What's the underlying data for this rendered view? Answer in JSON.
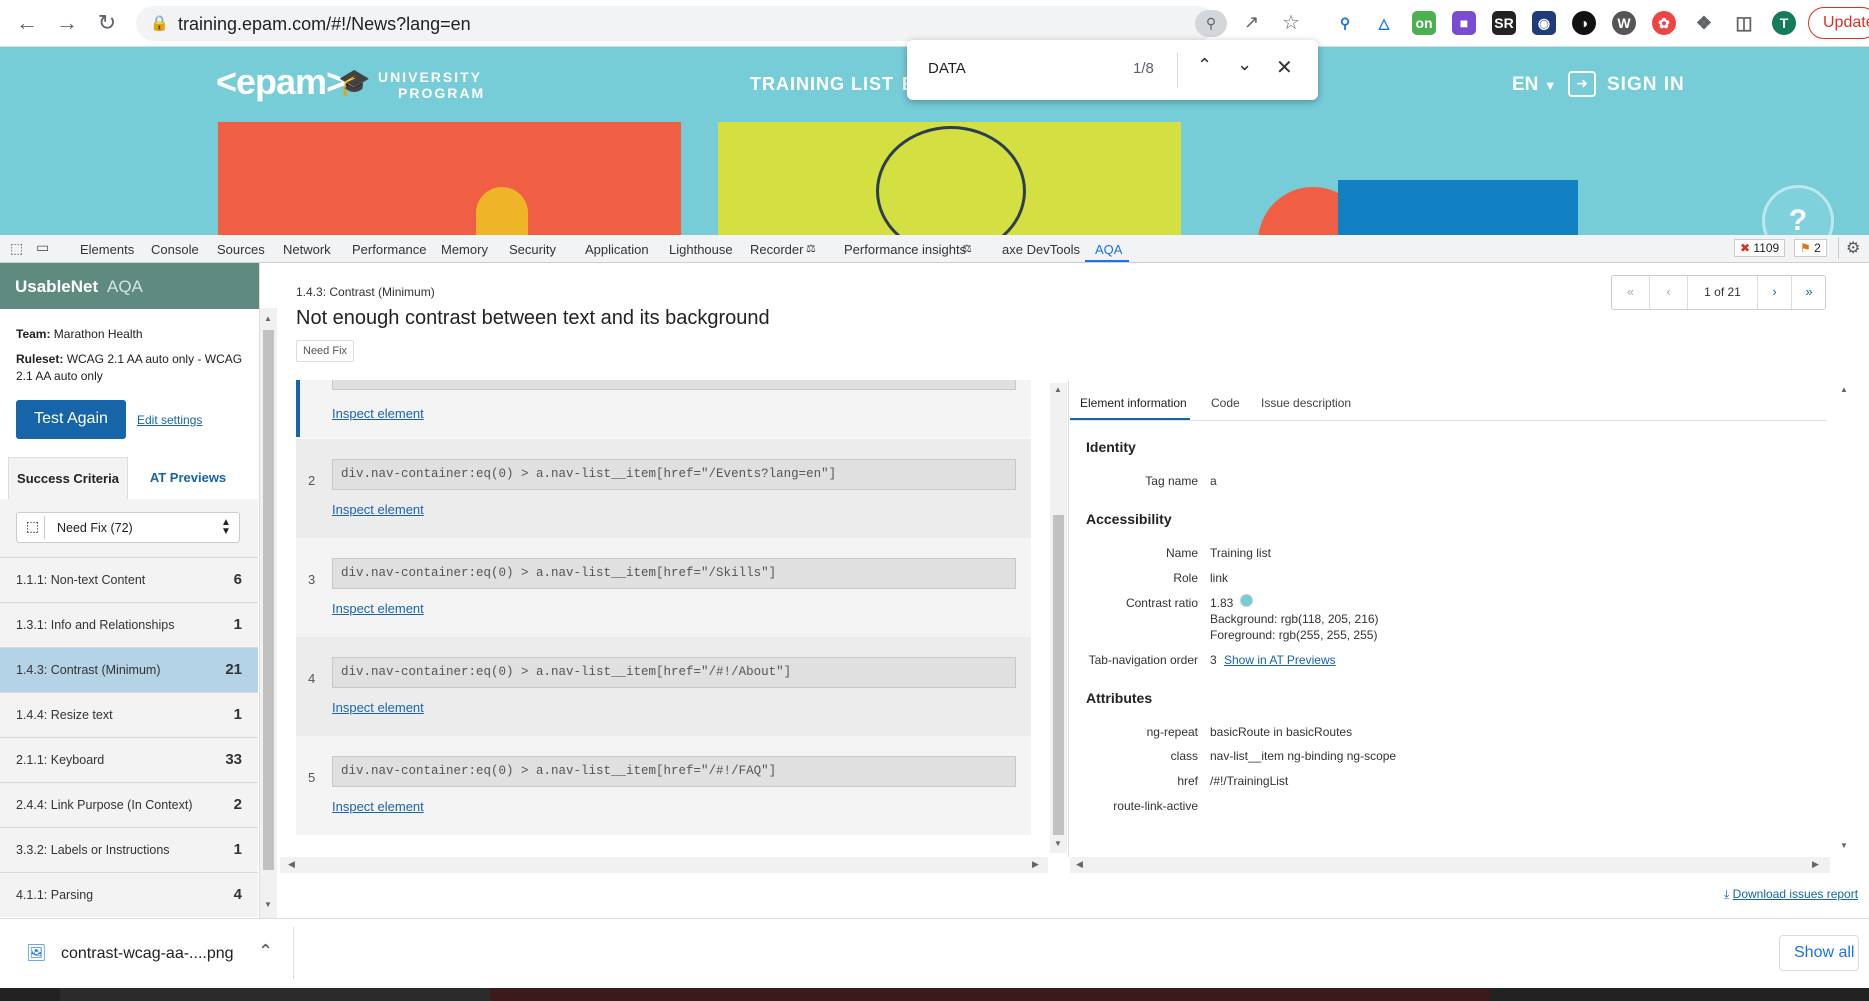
{
  "browser": {
    "url": "training.epam.com/#!/News?lang=en",
    "update_label": "Update",
    "profile_initial": "T"
  },
  "site": {
    "logo": "<epam>",
    "program_line1": "UNIVERSITY",
    "program_line2": "PROGRAM",
    "nav_training": "TRAINING LIST",
    "nav_e": "E",
    "lang": "EN",
    "sign_in": "SIGN IN",
    "help": "?"
  },
  "find": {
    "query": "DATA",
    "count": "1/8"
  },
  "devtools": {
    "tabs": [
      "Elements",
      "Console",
      "Sources",
      "Network",
      "Performance",
      "Memory",
      "Security",
      "Application",
      "Lighthouse",
      "Recorder",
      "Performance insights",
      "axe DevTools",
      "AQA"
    ],
    "errors": "1109",
    "warnings": "2"
  },
  "aqa": {
    "brand": "UsableNet",
    "brand_suffix": "AQA",
    "team_label": "Team:",
    "team": "Marathon Health",
    "ruleset_label": "Ruleset:",
    "ruleset": "WCAG 2.1 AA auto only - WCAG 2.1 AA auto only",
    "test_again": "Test Again",
    "edit_settings": "Edit settings",
    "tab_success": "Success Criteria",
    "tab_at": "AT Previews",
    "filter": "Need Fix (72)",
    "criteria": [
      {
        "label": "1.1.1: Non-text Content",
        "count": "6"
      },
      {
        "label": "1.3.1: Info and Relationships",
        "count": "1"
      },
      {
        "label": "1.4.3: Contrast (Minimum)",
        "count": "21"
      },
      {
        "label": "1.4.4: Resize text",
        "count": "1"
      },
      {
        "label": "2.1.1: Keyboard",
        "count": "33"
      },
      {
        "label": "2.4.4: Link Purpose (In Context)",
        "count": "2"
      },
      {
        "label": "3.3.2: Labels or Instructions",
        "count": "1"
      },
      {
        "label": "4.1.1: Parsing",
        "count": "4"
      }
    ]
  },
  "issue": {
    "criterion": "1.4.3: Contrast (Minimum)",
    "title": "Not enough contrast between text and its background",
    "status": "Need Fix",
    "pager": "1 of 21",
    "pager_first": "«",
    "pager_prev": "‹",
    "pager_next": "›",
    "pager_last": "»",
    "inspect": "Inspect element",
    "rows": [
      {
        "num": "2",
        "selector": "div.nav-container:eq(0) > a.nav-list__item[href=\"/Events?lang=en\"]"
      },
      {
        "num": "3",
        "selector": "div.nav-container:eq(0) > a.nav-list__item[href=\"/Skills\"]"
      },
      {
        "num": "4",
        "selector": "div.nav-container:eq(0) > a.nav-list__item[href=\"/#!/About\"]"
      },
      {
        "num": "5",
        "selector": "div.nav-container:eq(0) > a.nav-list__item[href=\"/#!/FAQ\"]"
      }
    ]
  },
  "detail": {
    "tabs": [
      "Element information",
      "Code",
      "Issue description"
    ],
    "identity": "Identity",
    "tag_label": "Tag name",
    "tag": "a",
    "accessibility": "Accessibility",
    "name_label": "Name",
    "name": "Training list",
    "role_label": "Role",
    "role": "link",
    "contrast_label": "Contrast ratio",
    "contrast": "1.83",
    "bg": "Background: rgb(118, 205, 216)",
    "fg": "Foreground: rgb(255, 255, 255)",
    "tab_label": "Tab-navigation order",
    "tab_order": "3",
    "show_at": "Show in AT Previews",
    "attributes": "Attributes",
    "attrs": [
      {
        "k": "ng-repeat",
        "v": "basicRoute in basicRoutes"
      },
      {
        "k": "class",
        "v": "nav-list__item ng-binding ng-scope"
      },
      {
        "k": "href",
        "v": "/#!/TrainingList"
      },
      {
        "k": "route-link-active",
        "v": ""
      }
    ],
    "download": "Download issues report"
  },
  "downloads": {
    "file": "contrast-wcag-aa-....png",
    "show_all": "Show all"
  },
  "colors": {
    "site": "#76cdd8",
    "selected": "#b5d3e6",
    "aqa_header": "#5e8a80",
    "primary": "#1565a8"
  }
}
